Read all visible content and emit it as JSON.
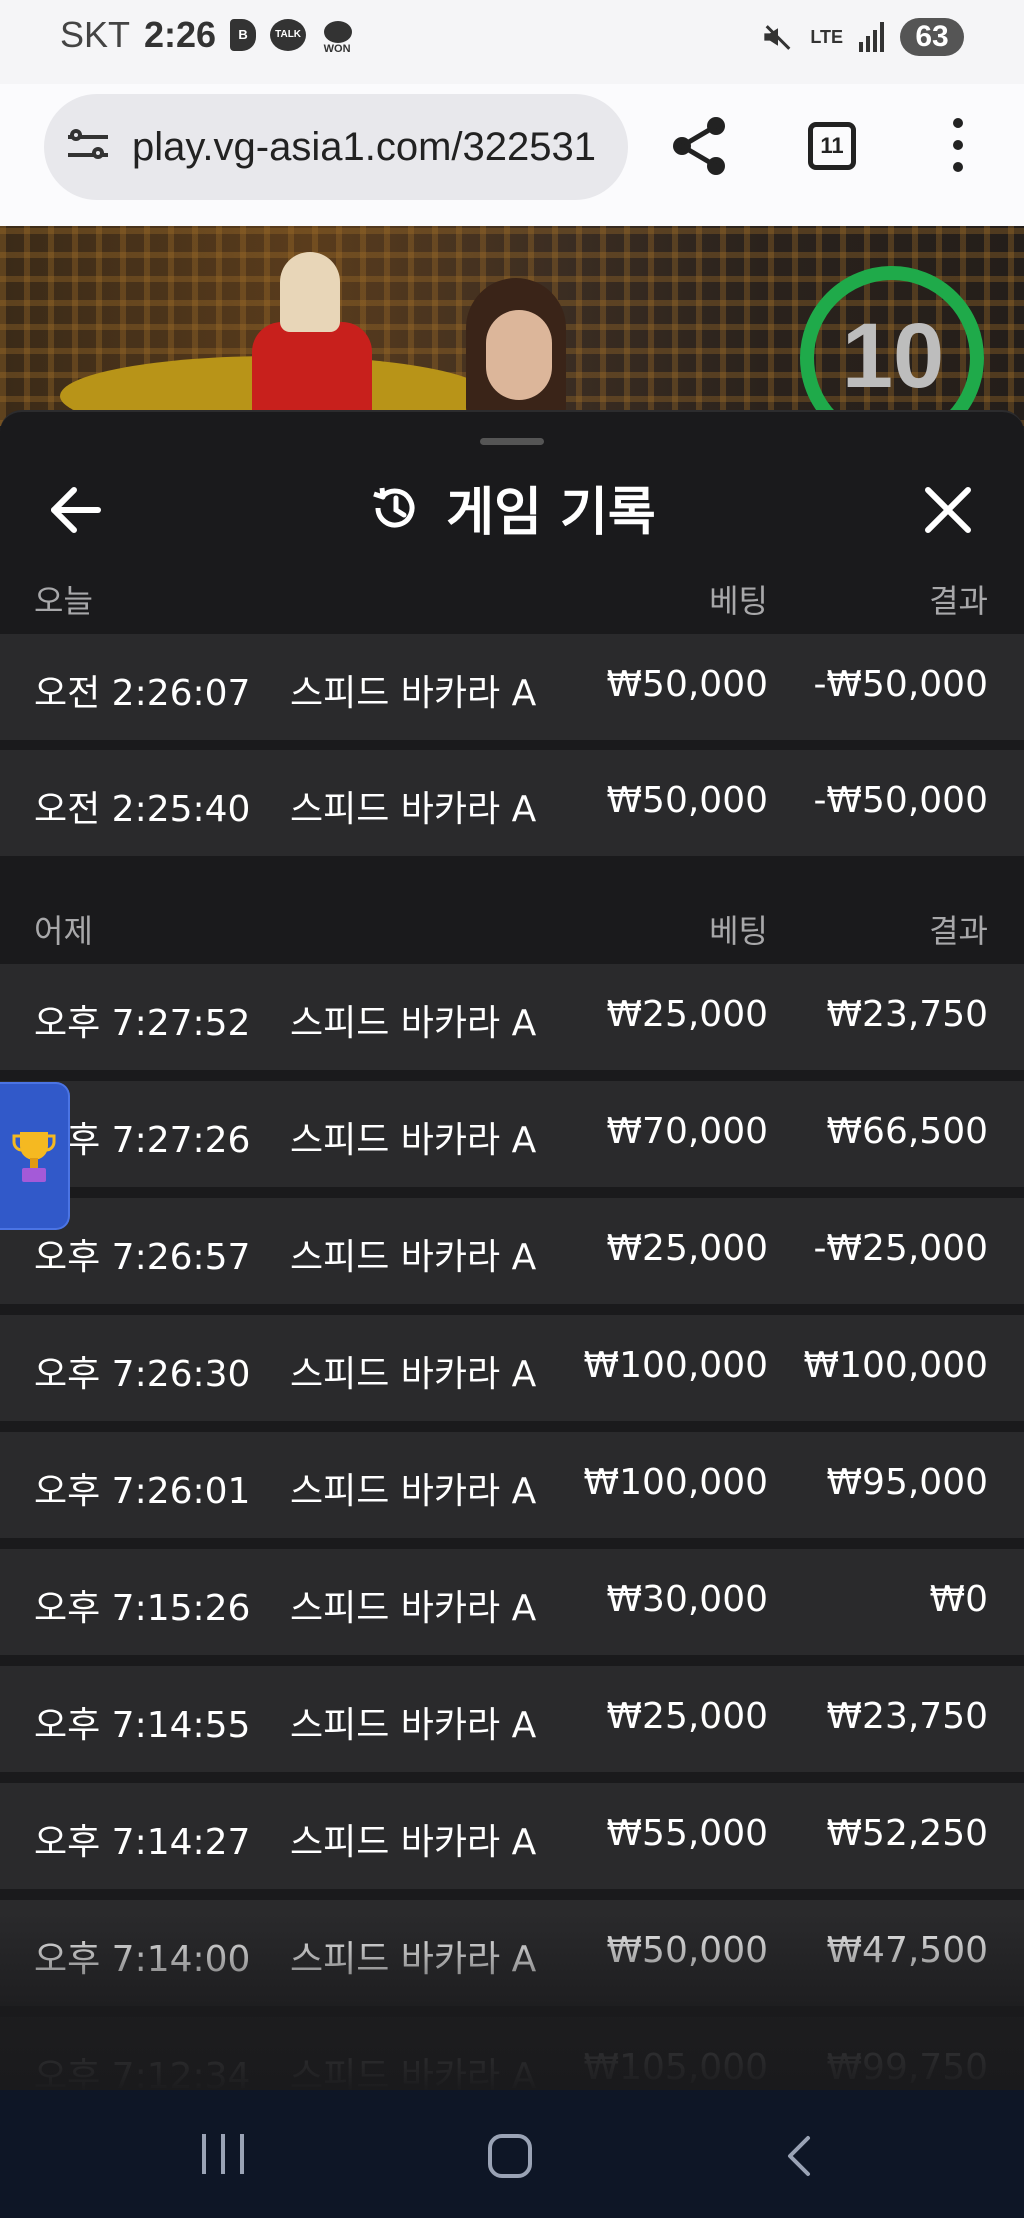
{
  "status_bar": {
    "carrier": "SKT",
    "time": "2:26",
    "app_icons": [
      "B",
      "TALK",
      "WON"
    ],
    "network": "LTE",
    "battery": "63"
  },
  "browser": {
    "url": "play.vg-asia1.com/322531",
    "tab_count": "11"
  },
  "video": {
    "countdown": "10"
  },
  "sheet": {
    "title": "게임 기록",
    "sections": [
      {
        "day": "오늘",
        "bet_header": "베팅",
        "result_header": "결과",
        "rows": [
          {
            "time": "오전 2:26:07",
            "game": "스피드 바카라 A",
            "bet": "₩50,000",
            "result": "-₩50,000"
          },
          {
            "time": "오전 2:25:40",
            "game": "스피드 바카라 A",
            "bet": "₩50,000",
            "result": "-₩50,000"
          }
        ]
      },
      {
        "day": "어제",
        "bet_header": "베팅",
        "result_header": "결과",
        "rows": [
          {
            "time": "오후 7:27:52",
            "game": "스피드 바카라 A",
            "bet": "₩25,000",
            "result": "₩23,750"
          },
          {
            "time": "오후 7:27:26",
            "game": "스피드 바카라 A",
            "bet": "₩70,000",
            "result": "₩66,500"
          },
          {
            "time": "오후 7:26:57",
            "game": "스피드 바카라 A",
            "bet": "₩25,000",
            "result": "-₩25,000"
          },
          {
            "time": "오후 7:26:30",
            "game": "스피드 바카라 A",
            "bet": "₩100,000",
            "result": "₩100,000"
          },
          {
            "time": "오후 7:26:01",
            "game": "스피드 바카라 A",
            "bet": "₩100,000",
            "result": "₩95,000"
          },
          {
            "time": "오후 7:15:26",
            "game": "스피드 바카라 A",
            "bet": "₩30,000",
            "result": "₩0"
          },
          {
            "time": "오후 7:14:55",
            "game": "스피드 바카라 A",
            "bet": "₩25,000",
            "result": "₩23,750"
          },
          {
            "time": "오후 7:14:27",
            "game": "스피드 바카라 A",
            "bet": "₩55,000",
            "result": "₩52,250"
          },
          {
            "time": "오후 7:14:00",
            "game": "스피드 바카라 A",
            "bet": "₩50,000",
            "result": "₩47,500"
          },
          {
            "time": "오후 7:12:34",
            "game": "스피드 바카라 A",
            "bet": "₩105,000",
            "result": "₩99,750"
          }
        ]
      }
    ]
  },
  "colors": {
    "sheet_bg": "#1a1a1c",
    "row_bg": "#2a2a2c",
    "timer_ring": "#1faa4a",
    "trophy_tab": "#3159c9",
    "navbar": "#0e1626"
  },
  "icons": [
    "tune-icon",
    "share-icon",
    "tabs-icon",
    "more-icon",
    "back-arrow-icon",
    "history-icon",
    "close-icon",
    "trophy-icon",
    "nav-recent-icon",
    "nav-home-icon",
    "nav-back-icon"
  ]
}
